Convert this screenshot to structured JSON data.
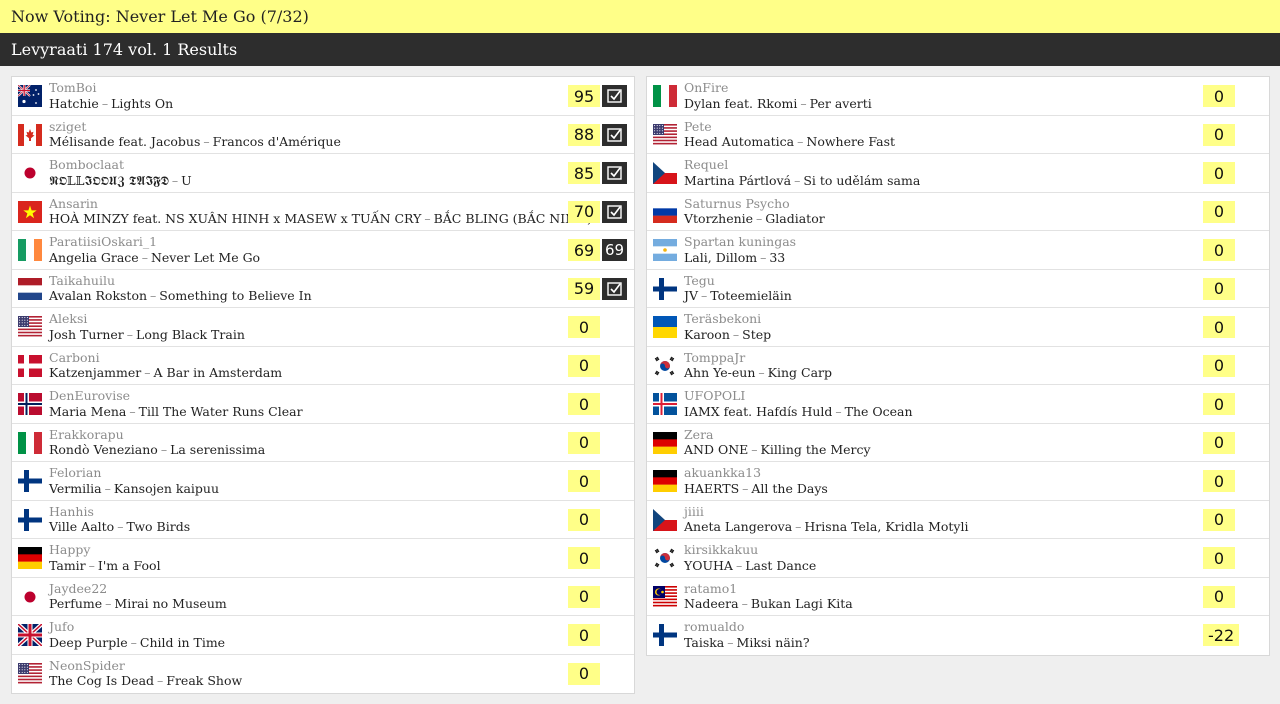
{
  "header": {
    "now_voting": "Now Voting: Never Let Me Go (7/32)"
  },
  "subheader": {
    "title": "Levyraati 174 vol. 1 Results"
  },
  "left": [
    {
      "flag": "au",
      "user": "TomBoi",
      "artist": "Hatchie",
      "title": "Lights On",
      "score": "95",
      "mark": "check"
    },
    {
      "flag": "ca",
      "user": "sziget",
      "artist": "Mélisande feat. Jacobus",
      "title": "Francos d'Amérique",
      "score": "88",
      "mark": "check"
    },
    {
      "flag": "jp",
      "user": "Bomboclaat",
      "artist": "𝕹𝕺𝕃𝕃𝕴𝕺𝕺𝖀𝖅 𝕿𝕬𝕴𝕱𝕯",
      "title": "U",
      "score": "85",
      "mark": "check"
    },
    {
      "flag": "vn",
      "user": "Ansarin",
      "artist": "HOÀ MINZY feat. NS XUÂN HINH x MASEW x TUẤN CRY",
      "title": "BẮC BLING (BẮC NINH)",
      "score": "70",
      "mark": "check"
    },
    {
      "flag": "ie",
      "user": "ParatiisiOskari_1",
      "artist": "Angelia Grace",
      "title": "Never Let Me Go",
      "score": "69",
      "mark": "69"
    },
    {
      "flag": "nl",
      "user": "Taikahuilu",
      "artist": "Avalan Rokston",
      "title": "Something to Believe In",
      "score": "59",
      "mark": "check"
    },
    {
      "flag": "us",
      "user": "Aleksi",
      "artist": "Josh Turner",
      "title": "Long Black Train",
      "score": "0",
      "mark": ""
    },
    {
      "flag": "dk",
      "user": "Carboni",
      "artist": "Katzenjammer",
      "title": "A Bar in Amsterdam",
      "score": "0",
      "mark": ""
    },
    {
      "flag": "no",
      "user": "DenEurovise",
      "artist": "Maria Mena",
      "title": "Till The Water Runs Clear",
      "score": "0",
      "mark": ""
    },
    {
      "flag": "it",
      "user": "Erakkorapu",
      "artist": "Rondò Veneziano",
      "title": "La serenissima",
      "score": "0",
      "mark": ""
    },
    {
      "flag": "fi",
      "user": "Felorian",
      "artist": "Vermilia",
      "title": "Kansojen kaipuu",
      "score": "0",
      "mark": ""
    },
    {
      "flag": "fi",
      "user": "Hanhis",
      "artist": "Ville Aalto",
      "title": "Two Birds",
      "score": "0",
      "mark": ""
    },
    {
      "flag": "de",
      "user": "Happy",
      "artist": "Tamir",
      "title": "I'm a Fool",
      "score": "0",
      "mark": ""
    },
    {
      "flag": "jp",
      "user": "Jaydee22",
      "artist": "Perfume",
      "title": "Mirai no Museum",
      "score": "0",
      "mark": ""
    },
    {
      "flag": "gb",
      "user": "Jufo",
      "artist": "Deep Purple",
      "title": "Child in Time",
      "score": "0",
      "mark": ""
    },
    {
      "flag": "us",
      "user": "NeonSpider",
      "artist": "The Cog Is Dead",
      "title": "Freak Show",
      "score": "0",
      "mark": ""
    }
  ],
  "right": [
    {
      "flag": "it",
      "user": "OnFire",
      "artist": "Dylan feat. Rkomi",
      "title": "Per averti",
      "score": "0",
      "mark": ""
    },
    {
      "flag": "us",
      "user": "Pete",
      "artist": "Head Automatica",
      "title": "Nowhere Fast",
      "score": "0",
      "mark": ""
    },
    {
      "flag": "cz",
      "user": "Requel",
      "artist": "Martina Pártlová",
      "title": "Si to udělám sama",
      "score": "0",
      "mark": ""
    },
    {
      "flag": "ru",
      "user": "Saturnus Psycho",
      "artist": "Vtorzhenie",
      "title": "Gladiator",
      "score": "0",
      "mark": ""
    },
    {
      "flag": "ar",
      "user": "Spartan kuningas",
      "artist": "Lali, Dillom",
      "title": "33",
      "score": "0",
      "mark": ""
    },
    {
      "flag": "fi",
      "user": "Tegu",
      "artist": "JV",
      "title": "Toteemieläin",
      "score": "0",
      "mark": ""
    },
    {
      "flag": "ua",
      "user": "Teräsbekoni",
      "artist": "Karoon",
      "title": "Step",
      "score": "0",
      "mark": ""
    },
    {
      "flag": "kr",
      "user": "TomppaJr",
      "artist": "Ahn Ye-eun",
      "title": "King Carp",
      "score": "0",
      "mark": ""
    },
    {
      "flag": "is",
      "user": "UFOPOLI",
      "artist": "IAMX feat. Hafdís Huld",
      "title": "The Ocean",
      "score": "0",
      "mark": ""
    },
    {
      "flag": "de",
      "user": "Zera",
      "artist": "AND ONE",
      "title": "Killing the Mercy",
      "score": "0",
      "mark": ""
    },
    {
      "flag": "de",
      "user": "akuankka13",
      "artist": "HAERTS",
      "title": "All the Days",
      "score": "0",
      "mark": ""
    },
    {
      "flag": "cz",
      "user": "jiiii",
      "artist": "Aneta Langerova",
      "title": "Hrisna Tela, Kridla Motyli",
      "score": "0",
      "mark": ""
    },
    {
      "flag": "kr",
      "user": "kirsikkakuu",
      "artist": "YOUHA",
      "title": "Last Dance",
      "score": "0",
      "mark": ""
    },
    {
      "flag": "my",
      "user": "ratamo1",
      "artist": "Nadeera",
      "title": "Bukan Lagi Kita",
      "score": "0",
      "mark": ""
    },
    {
      "flag": "fi",
      "user": "romualdo",
      "artist": "Taiska",
      "title": "Miksi näin?",
      "score": "-22",
      "mark": ""
    }
  ]
}
